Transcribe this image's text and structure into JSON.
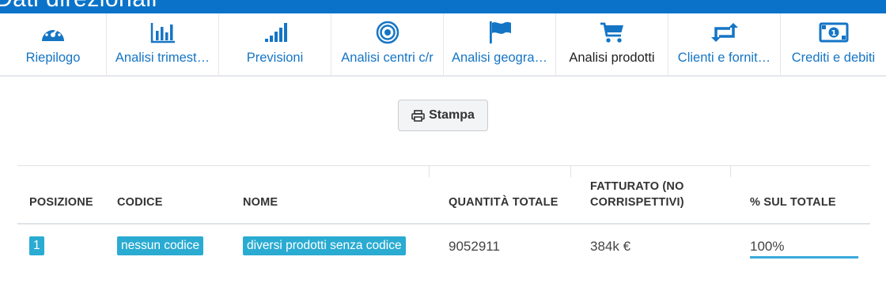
{
  "app": {
    "title": "Dati direzionali"
  },
  "nav": {
    "items": [
      {
        "label": "Riepilogo",
        "icon": "dashboard-icon"
      },
      {
        "label": "Analisi trimest…",
        "icon": "bar-chart-icon"
      },
      {
        "label": "Previsioni",
        "icon": "signal-icon"
      },
      {
        "label": "Analisi centri c/r",
        "icon": "target-icon"
      },
      {
        "label": "Analisi geogra…",
        "icon": "flag-icon"
      },
      {
        "label": "Analisi prodotti",
        "icon": "cart-icon"
      },
      {
        "label": "Clienti e fornit…",
        "icon": "retweet-icon"
      },
      {
        "label": "Crediti e debiti",
        "icon": "money-icon"
      }
    ],
    "active_index": 5
  },
  "toolbar": {
    "print_label": "Stampa",
    "print_icon": "print-icon"
  },
  "table": {
    "headers": {
      "posizione": "POSIZIONE",
      "codice": "CODICE",
      "nome": "NOME",
      "quantita": "QUANTITÀ TOTALE",
      "fatturato_line1": "FATTURATO (NO",
      "fatturato_line2": "CORRISPETTIVI)",
      "percentuale": "% SUL TOTALE"
    },
    "rows": [
      {
        "posizione": "1",
        "codice": "nessun codice",
        "nome": "diversi prodotti senza codice",
        "quantita": "9052911",
        "fatturato": "384k €",
        "percentuale": "100%",
        "percent_value": 1.0
      }
    ]
  },
  "colors": {
    "brand_blue": "#0a73c9",
    "link_blue": "#1575c5",
    "badge": "#2aabd2",
    "bar": "#3aa9dc"
  }
}
